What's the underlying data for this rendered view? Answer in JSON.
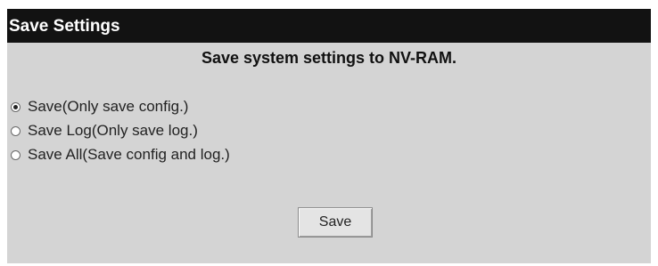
{
  "panel": {
    "title": "Save Settings",
    "heading": "Save system settings to NV-RAM."
  },
  "options": [
    {
      "label": "Save(Only save config.)",
      "checked": true
    },
    {
      "label": "Save Log(Only save log.)",
      "checked": false
    },
    {
      "label": "Save All(Save config and log.)",
      "checked": false
    }
  ],
  "actions": {
    "save_label": "Save"
  }
}
